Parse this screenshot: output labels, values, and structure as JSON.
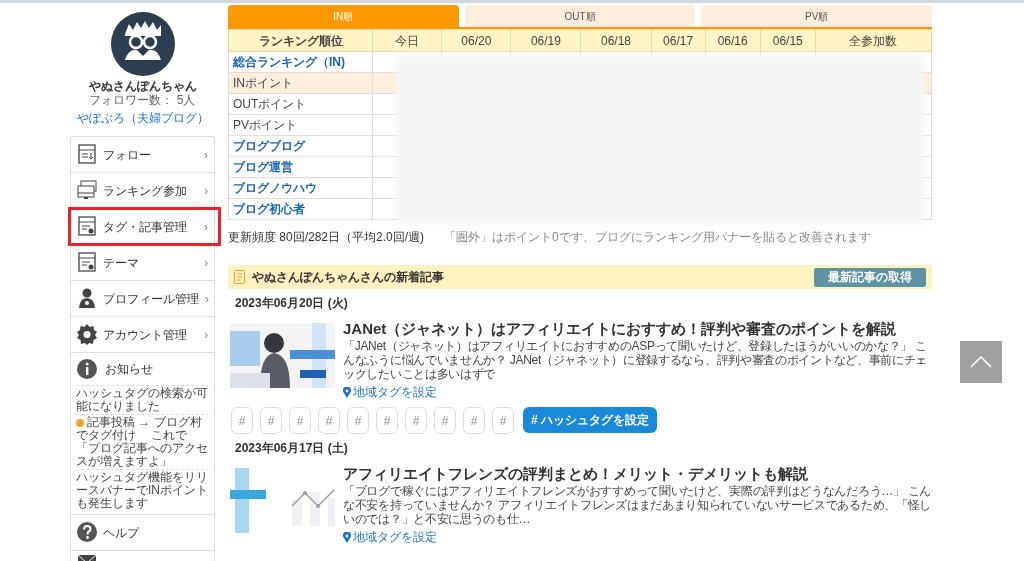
{
  "profile": {
    "name": "やぬさんぽんちゃん",
    "followers": "フォロワー数： 5人",
    "blog_link": "やぽぶろ（夫婦ブログ）"
  },
  "menu": [
    {
      "kind": "reader",
      "label": "フォロー",
      "arrow": "›",
      "highlighted": false
    },
    {
      "kind": "banner",
      "label": "ランキング参加",
      "arrow": "›",
      "highlighted": false
    },
    {
      "kind": "post",
      "label": "タグ・記事管理",
      "arrow": "›",
      "highlighted": true
    },
    {
      "kind": "theme",
      "label": "テーマ",
      "arrow": "›",
      "highlighted": false
    },
    {
      "kind": "person",
      "label": "プロフィール管理",
      "arrow": "›",
      "highlighted": false
    },
    {
      "kind": "gear",
      "label": "アカウント管理",
      "arrow": "›",
      "highlighted": false
    },
    {
      "kind": "info",
      "label": "お知らせ",
      "news": [
        {
          "text": "ハッシュタグの検索が可能になりました",
          "emoji": false
        },
        {
          "text": "記事投稿 → ブログ村でタグ付け　 これで「ブログ記事へのアクセスが増えますよ」",
          "emoji": true
        },
        {
          "text": "ハッシュタグ機能をリリースバナーでINポイントも発生します",
          "emoji": false
        }
      ],
      "highlighted": false
    },
    {
      "kind": "help",
      "label": "ヘルプ",
      "highlighted": false
    },
    {
      "kind": "mail",
      "highlighted": false
    }
  ],
  "tabs": [
    {
      "label": "IN順",
      "selected": true
    },
    {
      "label": "OUT順",
      "selected": false
    },
    {
      "label": "PV順",
      "selected": false
    }
  ],
  "table": {
    "columns": [
      "ランキング順位",
      "今日",
      "06/20",
      "06/19",
      "06/18",
      "06/17",
      "06/16",
      "06/15",
      "全参加数"
    ],
    "rows": [
      {
        "label": "総合ランキング（IN)",
        "kind": "link",
        "highlighted": false
      },
      {
        "label": "INポイント",
        "kind": "plain",
        "highlighted": true
      },
      {
        "label": "OUTポイント",
        "kind": "plain",
        "highlighted": false
      },
      {
        "label": "PVポイント",
        "kind": "plain",
        "highlighted": false
      },
      {
        "label": "ブログブログ",
        "kind": "link",
        "highlighted": false
      },
      {
        "label": "ブログ運営",
        "kind": "link",
        "highlighted": false
      },
      {
        "label": "ブログノウハウ",
        "kind": "link",
        "highlighted": false
      },
      {
        "label": "ブログ初心者",
        "kind": "link",
        "highlighted": false
      }
    ]
  },
  "update_frequency": "更新頻度 80回/282日（平均2.0回/週)",
  "note": "「圏外」はポイント0です、ブログにランキング用バナーを貼ると改善されます",
  "recent": {
    "title": "やぬさんぽんちゃんさんの新着記事",
    "fetch_button": "最新記事の取得",
    "articles": [
      {
        "date": "2023年06月20日 (火)",
        "title": "JANet（ジャネット）はアフィリエイトにおすすめ！評判や審査のポイントを解説",
        "excerpt": "「JANet（ジャネット）はアフィリエイトにおすすめのASPって聞いたけど、登録したほうがいいのかな？」 こんなふうに悩んでいませんか？ JANet（ジャネット）に登録するなら、評判や審査のポイントなど、事前にチェックしたいことは多いはずで",
        "location": "地域タグを設定",
        "tag_slots": [
          "#",
          "#",
          "#",
          "#",
          "#",
          "#",
          "#",
          "#",
          "#",
          "#"
        ],
        "hashtag_button": "# ハッシュタグを設定"
      },
      {
        "date": "2023年06月17日 (土)",
        "title": "アフィリエイトフレンズの評判まとめ！メリット・デメリットも解説",
        "excerpt": "「ブログで稼ぐにはアフィリエイトフレンズがおすすめって聞いたけど、実際の評判はどうなんだろう…」 こんな不安を持っていませんか？ アフィリエイトフレンズはまだあまり知られていないサービスであるため、「怪しいのでは？」と不安に思うのも仕…",
        "location": "地域タグを設定"
      }
    ]
  }
}
